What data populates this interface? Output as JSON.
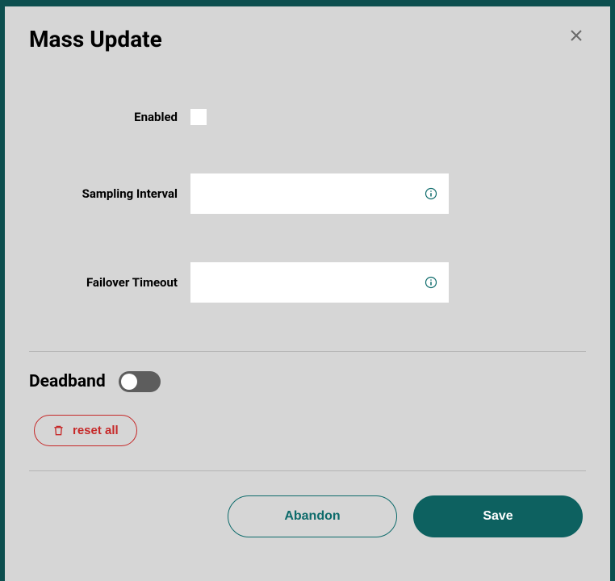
{
  "modal": {
    "title": "Mass Update"
  },
  "form": {
    "enabled_label": "Enabled",
    "sampling_interval_label": "Sampling Interval",
    "sampling_interval_value": "",
    "failover_timeout_label": "Failover Timeout",
    "failover_timeout_value": ""
  },
  "sections": {
    "deadband_label": "Deadband",
    "deadband_on": false
  },
  "actions": {
    "reset_all_label": "reset all",
    "abandon_label": "Abandon",
    "save_label": "Save"
  }
}
